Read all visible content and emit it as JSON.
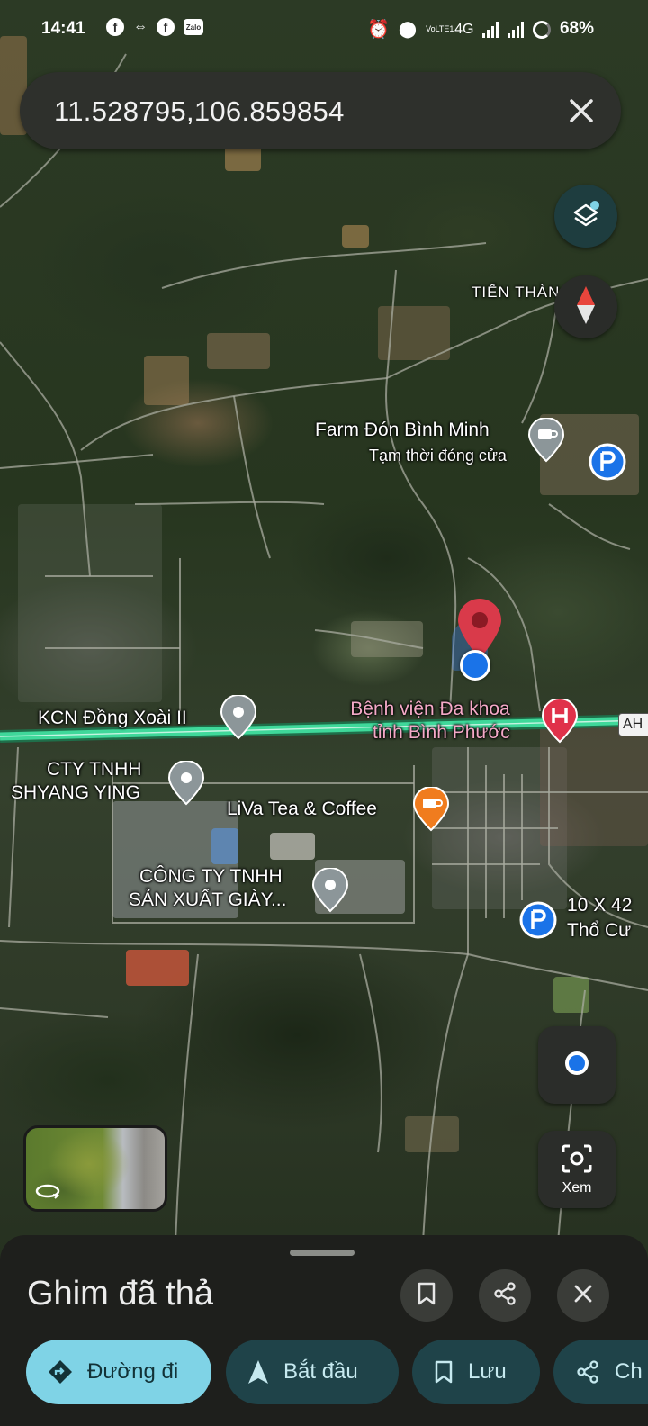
{
  "status_bar": {
    "time": "14:41",
    "apps": [
      "facebook-icon",
      "link-icon",
      "facebook-icon",
      "zalo-icon"
    ],
    "zalo_label": "Zalo",
    "network_label": "4G",
    "volte_label": "VoLTE1",
    "battery": "68%"
  },
  "search": {
    "query": "11.528795,106.859854"
  },
  "map": {
    "labels": {
      "tien_thanh": "TIẾN THÀN",
      "farm_name": "Farm Đón Bình Minh",
      "farm_status": "Tạm thời đóng cửa",
      "kcn": "KCN Đồng Xoài II",
      "hospital_line1": "Bệnh viện Đa khoa",
      "hospital_line2": "tỉnh Bình Phước",
      "road_shield": "AH",
      "cty_line1": "CTY TNHH",
      "cty_line2": "SHYANG YING",
      "liva": "LiVa Tea & Coffee",
      "congty_line1": "CÔNG TY TNHH",
      "congty_line2": "SẢN XUẤT GIÀY...",
      "parking_line1": "10 X 42",
      "parking_line2": "Thổ Cư"
    },
    "colors": {
      "pin_red": "#d93a4a",
      "location_blue": "#1a73e8",
      "highway": "#3fd89a",
      "hospital": "#e0314a",
      "cafe": "#f07c1e",
      "parking": "#1a73e8",
      "poi_gray": "#8c9699"
    }
  },
  "buttons": {
    "lens_label": "Xem"
  },
  "sheet": {
    "title": "Ghim đã thả",
    "chips": {
      "directions": "Đường đi",
      "start": "Bắt đầu",
      "save": "Lưu",
      "share": "Ch"
    }
  }
}
